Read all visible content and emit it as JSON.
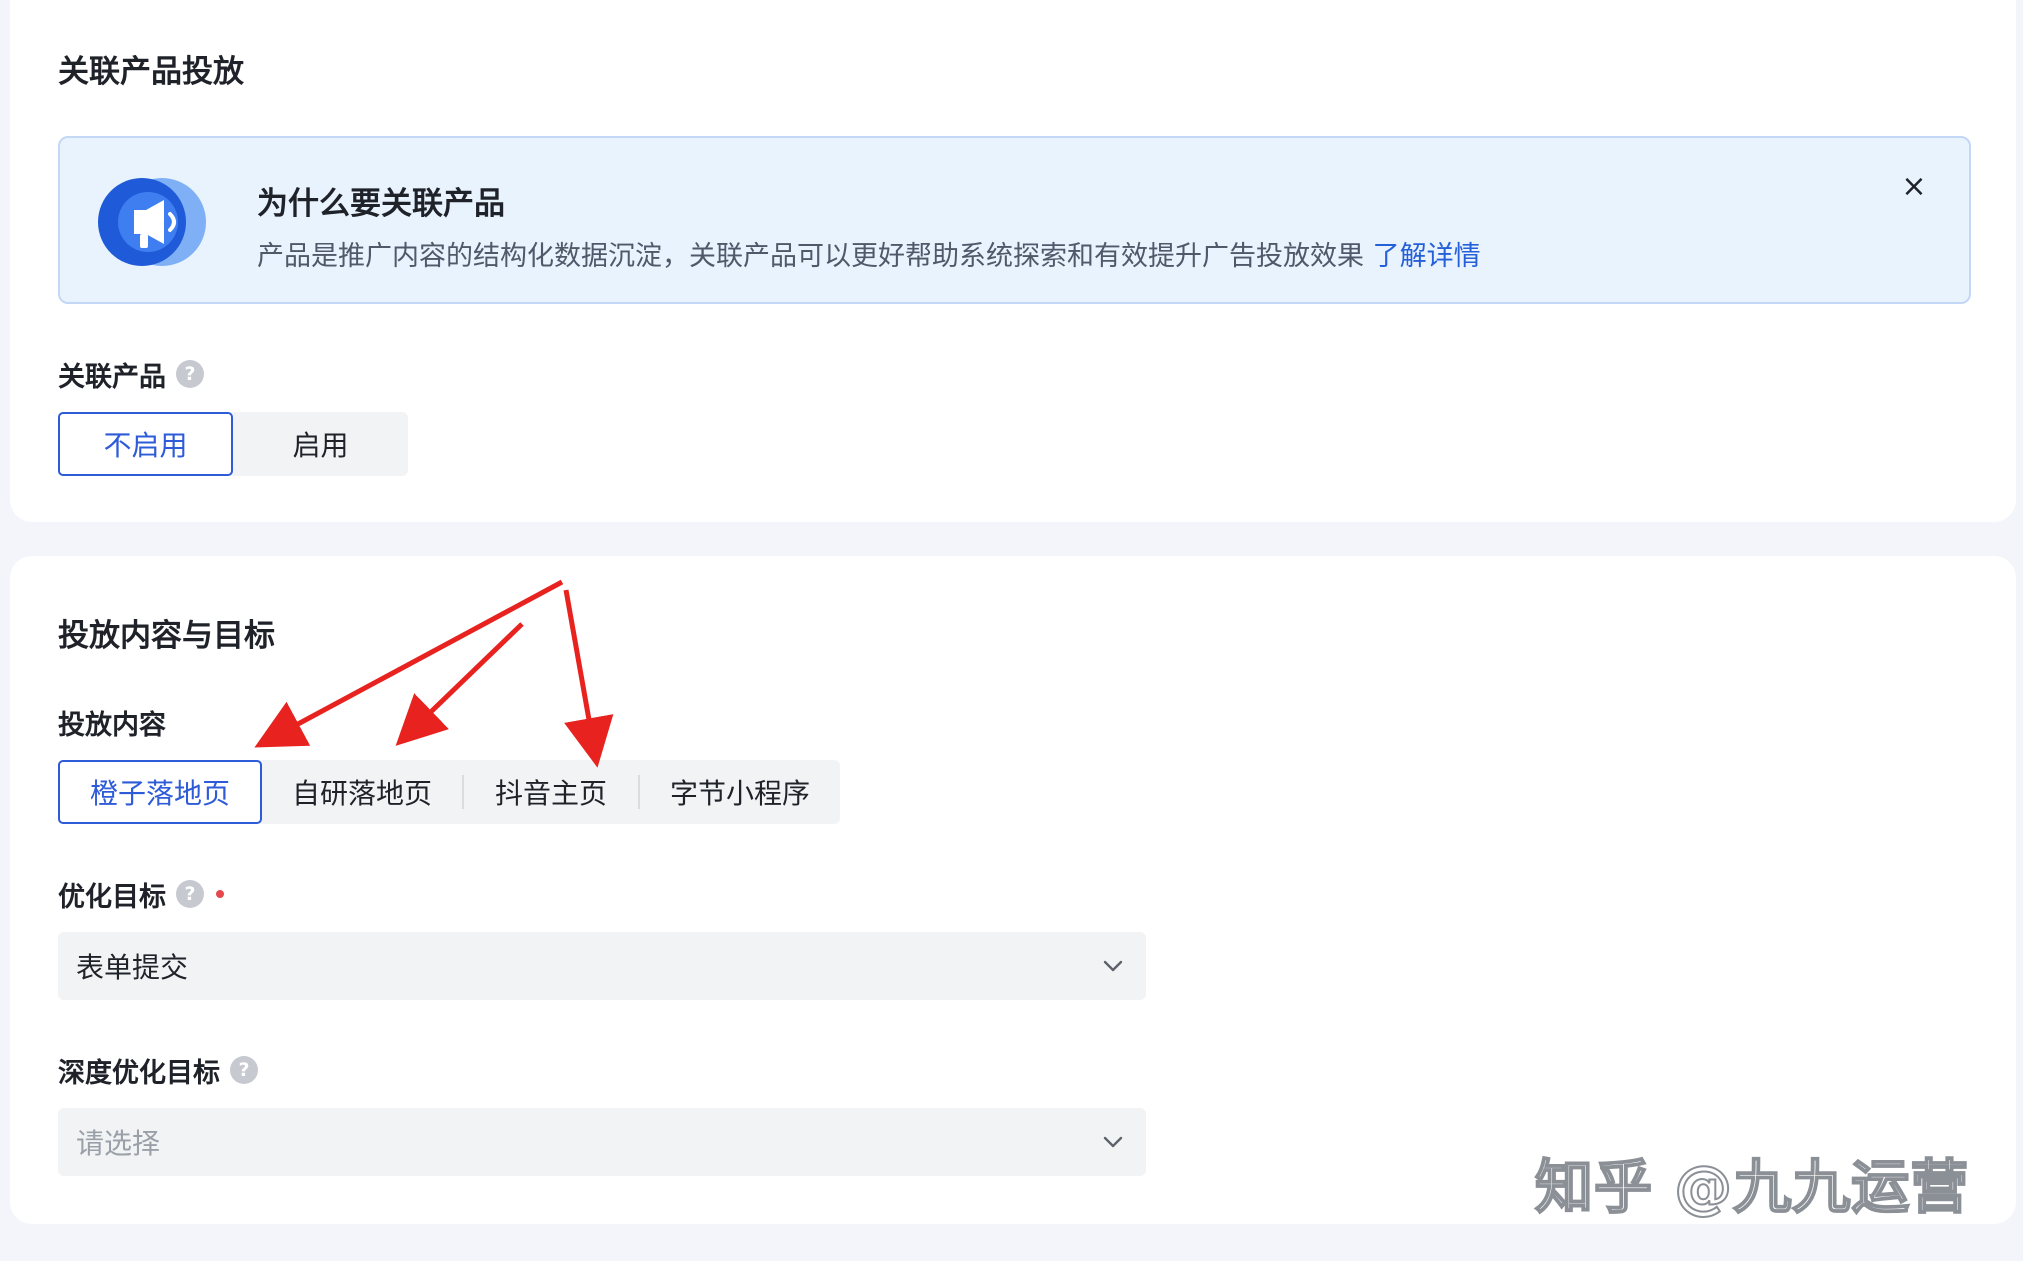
{
  "section1": {
    "title": "关联产品投放",
    "notice": {
      "title": "为什么要关联产品",
      "description": "产品是推广内容的结构化数据沉淀，关联产品可以更好帮助系统探索和有效提升广告投放效果",
      "link": "了解详情",
      "close_icon": "×"
    },
    "related_product": {
      "label": "关联产品",
      "help_icon": "?",
      "options": [
        "不启用",
        "启用"
      ],
      "selected": "不启用"
    }
  },
  "section2": {
    "title": "投放内容与目标",
    "delivery_content": {
      "label": "投放内容",
      "options": [
        "橙子落地页",
        "自研落地页",
        "抖音主页",
        "字节小程序"
      ],
      "selected": "橙子落地页"
    },
    "optimization_goal": {
      "label": "优化目标",
      "help_icon": "?",
      "required": true,
      "value": "表单提交"
    },
    "deep_optimization_goal": {
      "label": "深度优化目标",
      "help_icon": "?",
      "placeholder": "请选择"
    }
  },
  "watermark": "知乎 @九九运营",
  "colors": {
    "accent": "#2e5bd8",
    "link": "#2560d9",
    "notice_bg": "#e9f3fe",
    "annotation_arrow": "#e8231f"
  }
}
